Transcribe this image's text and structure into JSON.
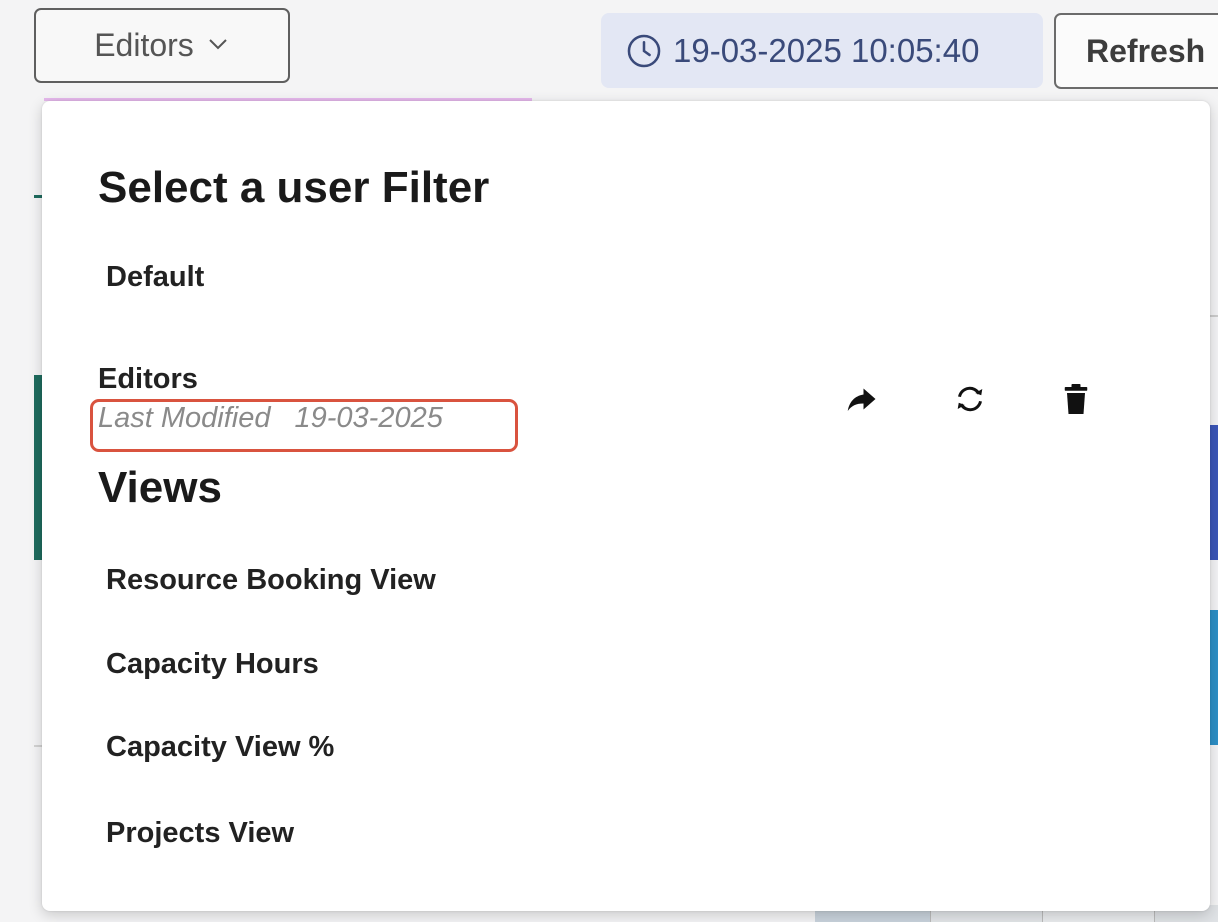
{
  "toolbar": {
    "filter_dropdown_label": "Editors",
    "timestamp": "19-03-2025 10:05:40",
    "refresh_label": "Refresh",
    "icons": {
      "dropdown": "chevron-down-icon",
      "timestamp": "clock-icon"
    }
  },
  "filter_panel": {
    "heading": "Select a user Filter",
    "default_item": "Default",
    "saved_filter": {
      "name": "Editors",
      "last_modified_label": "Last Modified",
      "last_modified_date": "19-03-2025",
      "actions": [
        "share-icon",
        "reload-icon",
        "trash-icon"
      ]
    },
    "views_heading": "Views",
    "views": [
      "Resource Booking View",
      "Capacity Hours",
      "Capacity View %",
      "Projects View"
    ]
  },
  "colors": {
    "timestamp_bg": "#e3e7f4",
    "timestamp_text": "#3a4a7a",
    "highlight_border": "#d9533f",
    "muted_text": "#8a8a8a"
  }
}
